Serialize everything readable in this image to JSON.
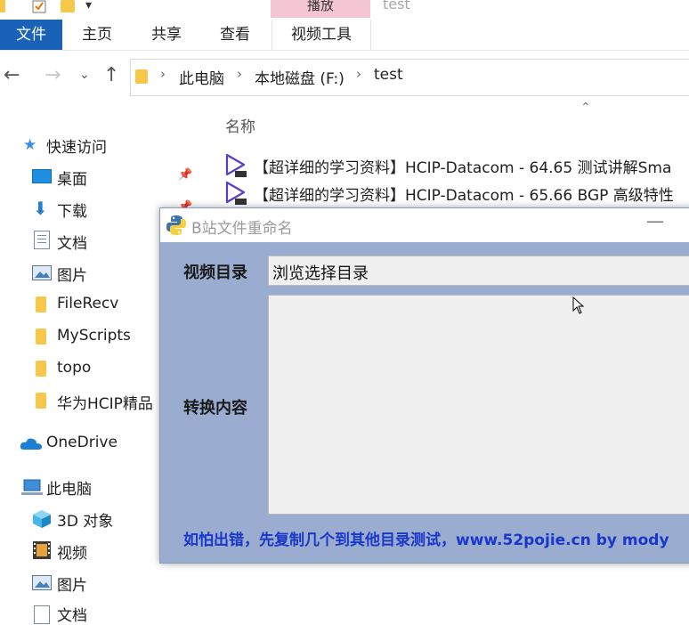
{
  "window": {
    "title": "test",
    "context_tab": "播放"
  },
  "ribbon": {
    "tabs": [
      "文件",
      "主页",
      "共享",
      "查看",
      "视频工具"
    ]
  },
  "address": {
    "crumbs": [
      "此电脑",
      "本地磁盘 (F:)",
      "test"
    ]
  },
  "nav": {
    "quick_access": "快速访问",
    "items": [
      {
        "label": "桌面",
        "icon": "desktop-icon",
        "pinned": true
      },
      {
        "label": "下载",
        "icon": "download-icon",
        "pinned": true
      },
      {
        "label": "文档",
        "icon": "documents-icon"
      },
      {
        "label": "图片",
        "icon": "pictures-icon"
      },
      {
        "label": "FileRecv",
        "icon": "folder-icon"
      },
      {
        "label": "MyScripts",
        "icon": "folder-icon"
      },
      {
        "label": "topo",
        "icon": "folder-icon"
      },
      {
        "label": "华为HCIP精品",
        "icon": "folder-icon"
      }
    ],
    "onedrive": "OneDrive",
    "this_pc": "此电脑",
    "pc_items": [
      {
        "label": "3D 对象",
        "icon": "3d-objects-icon"
      },
      {
        "label": "视频",
        "icon": "videos-icon"
      },
      {
        "label": "图片",
        "icon": "pictures-icon"
      },
      {
        "label": "文档",
        "icon": "documents-icon"
      }
    ]
  },
  "filelist": {
    "column_name": "名称",
    "files": [
      "【超详细的学习资料】HCIP-Datacom - 64.65 测试讲解Sma",
      "【超详细的学习资料】HCIP-Datacom - 65.66 BGP 高级特性"
    ]
  },
  "dialog": {
    "title": "B站文件重命名",
    "dir_label": "视频目录",
    "dir_value": "浏览选择目录",
    "content_label": "转换内容",
    "footer": "如怕出错，先复制几个到其他目录测试，www.52pojie.cn by mody"
  },
  "colors": {
    "file_tab": "#1a62b8",
    "context_tab": "#f4c6d3",
    "dialog_bg": "#9aaccf",
    "footer_text": "#1a38c8"
  }
}
